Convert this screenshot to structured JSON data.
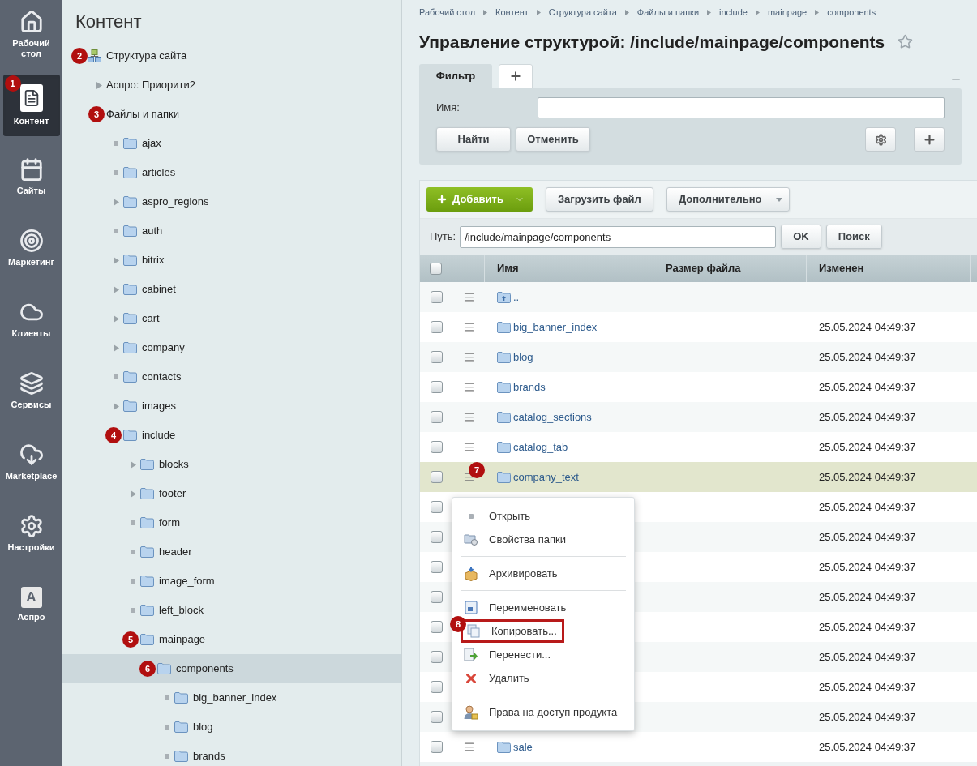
{
  "sidebar": {
    "items": [
      {
        "label": "Рабочий стол",
        "kind": "home",
        "selected": false
      },
      {
        "label": "Контент",
        "kind": "content",
        "selected": true,
        "badge": "1"
      },
      {
        "label": "Сайты",
        "kind": "sites",
        "selected": false
      },
      {
        "label": "Маркетинг",
        "kind": "marketing",
        "selected": false
      },
      {
        "label": "Клиенты",
        "kind": "clients",
        "selected": false
      },
      {
        "label": "Сервисы",
        "kind": "services",
        "selected": false
      },
      {
        "label": "Marketplace",
        "kind": "marketplace",
        "selected": false
      },
      {
        "label": "Настройки",
        "kind": "settings",
        "selected": false
      },
      {
        "label": "Аспро",
        "kind": "letter",
        "logo_text": "A",
        "selected": false
      }
    ]
  },
  "tree": {
    "title": "Контент",
    "items": [
      {
        "label": "Структура сайта",
        "kind": "site",
        "badge": "2",
        "selected": false,
        "children": [
          {
            "label": "Аспро: Приорити2",
            "kind": "section",
            "expanded": false,
            "selected": false
          },
          {
            "label": "Файлы и папки",
            "kind": "section",
            "badge": "3",
            "selected": false,
            "children": [
              {
                "label": "ajax",
                "kind": "folder",
                "selected": false
              },
              {
                "label": "articles",
                "kind": "folder",
                "selected": false
              },
              {
                "label": "aspro_regions",
                "kind": "folder",
                "expanded": false,
                "selected": false
              },
              {
                "label": "auth",
                "kind": "folder",
                "selected": false
              },
              {
                "label": "bitrix",
                "kind": "folder",
                "expanded": false,
                "selected": false
              },
              {
                "label": "cabinet",
                "kind": "folder",
                "expanded": false,
                "selected": false
              },
              {
                "label": "cart",
                "kind": "folder",
                "expanded": false,
                "selected": false
              },
              {
                "label": "company",
                "kind": "folder",
                "expanded": false,
                "selected": false
              },
              {
                "label": "contacts",
                "kind": "folder",
                "selected": false
              },
              {
                "label": "images",
                "kind": "folder",
                "expanded": false,
                "selected": false
              },
              {
                "label": "include",
                "kind": "folder",
                "badge": "4",
                "selected": false,
                "children": [
                  {
                    "label": "blocks",
                    "kind": "folder",
                    "expanded": false,
                    "selected": false
                  },
                  {
                    "label": "footer",
                    "kind": "folder",
                    "expanded": false,
                    "selected": false
                  },
                  {
                    "label": "form",
                    "kind": "folder",
                    "selected": false
                  },
                  {
                    "label": "header",
                    "kind": "folder",
                    "selected": false
                  },
                  {
                    "label": "image_form",
                    "kind": "folder",
                    "selected": false
                  },
                  {
                    "label": "left_block",
                    "kind": "folder",
                    "selected": false
                  },
                  {
                    "label": "mainpage",
                    "kind": "folder",
                    "badge": "5",
                    "selected": false,
                    "children": [
                      {
                        "label": "components",
                        "kind": "folder",
                        "badge": "6",
                        "selected": true,
                        "children": [
                          {
                            "label": "big_banner_index",
                            "kind": "folder",
                            "selected": false
                          },
                          {
                            "label": "blog",
                            "kind": "folder",
                            "selected": false
                          },
                          {
                            "label": "brands",
                            "kind": "folder",
                            "selected": false
                          }
                        ]
                      }
                    ]
                  }
                ]
              }
            ]
          }
        ]
      }
    ]
  },
  "breadcrumbs": [
    "Рабочий стол",
    "Контент",
    "Структура сайта",
    "Файлы и папки",
    "include",
    "mainpage",
    "components"
  ],
  "page_title": "Управление структурой: /include/mainpage/components",
  "filter": {
    "tabs": [
      {
        "label": "Фильтр",
        "kind": "text",
        "selected": true
      },
      {
        "kind": "add",
        "selected": false
      }
    ],
    "field_label": "Имя:",
    "buttons": [
      "Найти",
      "Отменить"
    ]
  },
  "toolbar": {
    "add_button": "Добавить",
    "buttons": [
      "Загрузить файл"
    ],
    "more_button": "Дополнительно"
  },
  "path": {
    "label": "Путь:",
    "value": "/include/mainpage/components",
    "buttons": [
      "OK",
      "Поиск"
    ]
  },
  "table": {
    "select_all_checked": false,
    "columns": [
      "Имя",
      "Размер файла",
      "Изменен"
    ],
    "rows": [
      {
        "name": "..",
        "kind": "up",
        "checked": false,
        "selected": false
      },
      {
        "name": "big_banner_index",
        "modified": "25.05.2024 04:49:37",
        "kind": "folder",
        "checked": false,
        "selected": false
      },
      {
        "name": "blog",
        "modified": "25.05.2024 04:49:37",
        "kind": "folder",
        "checked": false,
        "selected": false
      },
      {
        "name": "brands",
        "modified": "25.05.2024 04:49:37",
        "kind": "folder",
        "checked": false,
        "selected": false
      },
      {
        "name": "catalog_sections",
        "modified": "25.05.2024 04:49:37",
        "kind": "folder",
        "checked": false,
        "selected": false
      },
      {
        "name": "catalog_tab",
        "modified": "25.05.2024 04:49:37",
        "kind": "folder",
        "checked": false,
        "selected": false
      },
      {
        "name": "company_text",
        "modified": "25.05.2024 04:49:37",
        "kind": "folder",
        "checked": false,
        "selected": true,
        "badge": "7"
      },
      {
        "modified": "25.05.2024 04:49:37",
        "kind": "hidden",
        "checked": false,
        "selected": false
      },
      {
        "modified": "25.05.2024 04:49:37",
        "kind": "hidden",
        "checked": false,
        "selected": false
      },
      {
        "modified": "25.05.2024 04:49:37",
        "kind": "hidden",
        "checked": false,
        "selected": false
      },
      {
        "modified": "25.05.2024 04:49:37",
        "kind": "hidden",
        "checked": false,
        "selected": false
      },
      {
        "modified": "25.05.2024 04:49:37",
        "kind": "hidden",
        "checked": false,
        "selected": false
      },
      {
        "modified": "25.05.2024 04:49:37",
        "kind": "hidden",
        "checked": false,
        "selected": false
      },
      {
        "modified": "25.05.2024 04:49:37",
        "kind": "hidden",
        "checked": false,
        "selected": false
      },
      {
        "modified": "25.05.2024 04:49:37",
        "kind": "hidden",
        "checked": false,
        "selected": false
      },
      {
        "name": "sale",
        "modified": "25.05.2024 04:49:37",
        "kind": "folder",
        "checked": false,
        "selected": false
      }
    ]
  },
  "context_menu": {
    "items": [
      {
        "label": "Открыть",
        "kind": "open",
        "highlighted": false
      },
      {
        "label": "Свойства папки",
        "kind": "properties",
        "highlighted": false
      },
      {
        "kind": "separator"
      },
      {
        "label": "Архивировать",
        "kind": "archive",
        "highlighted": false
      },
      {
        "kind": "separator"
      },
      {
        "label": "Переименовать",
        "kind": "rename",
        "highlighted": false
      },
      {
        "label": "Копировать...",
        "kind": "copy",
        "highlighted": true,
        "badge": "8"
      },
      {
        "label": "Перенести...",
        "kind": "move",
        "highlighted": false
      },
      {
        "label": "Удалить",
        "kind": "delete",
        "highlighted": false
      },
      {
        "kind": "separator"
      },
      {
        "label": "Права на доступ продукта",
        "kind": "access",
        "highlighted": false
      }
    ]
  }
}
